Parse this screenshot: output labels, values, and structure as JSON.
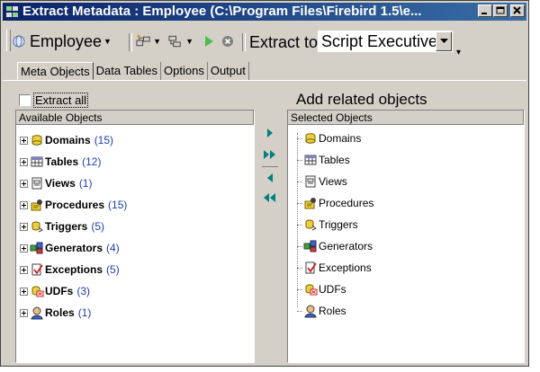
{
  "window": {
    "title": "Extract Metadata : Employee (C:\\Program Files\\Firebird 1.5\\e..."
  },
  "toolbar": {
    "database": "Employee",
    "extract_to_label": "Extract to",
    "extract_to_value": "Script Executive"
  },
  "tabs": [
    {
      "label": "Meta Objects",
      "active": true
    },
    {
      "label": "Data Tables",
      "active": false
    },
    {
      "label": "Options",
      "active": false
    },
    {
      "label": "Output",
      "active": false
    }
  ],
  "extract_all_label": "Extract all",
  "add_related_label": "Add related objects",
  "available": {
    "header": "Available Objects",
    "items": [
      {
        "name": "Domains",
        "count": "(15)",
        "icon": "domain-icon"
      },
      {
        "name": "Tables",
        "count": "(12)",
        "icon": "table-icon"
      },
      {
        "name": "Views",
        "count": "(1)",
        "icon": "view-icon"
      },
      {
        "name": "Procedures",
        "count": "(15)",
        "icon": "procedure-icon"
      },
      {
        "name": "Triggers",
        "count": "(5)",
        "icon": "trigger-icon"
      },
      {
        "name": "Generators",
        "count": "(4)",
        "icon": "generator-icon"
      },
      {
        "name": "Exceptions",
        "count": "(5)",
        "icon": "exception-icon"
      },
      {
        "name": "UDFs",
        "count": "(3)",
        "icon": "udf-icon"
      },
      {
        "name": "Roles",
        "count": "(1)",
        "icon": "role-icon"
      }
    ]
  },
  "selected": {
    "header": "Selected Objects",
    "items": [
      {
        "name": "Domains",
        "icon": "domain-icon"
      },
      {
        "name": "Tables",
        "icon": "table-icon"
      },
      {
        "name": "Views",
        "icon": "view-icon"
      },
      {
        "name": "Procedures",
        "icon": "procedure-icon"
      },
      {
        "name": "Triggers",
        "icon": "trigger-icon"
      },
      {
        "name": "Generators",
        "icon": "generator-icon"
      },
      {
        "name": "Exceptions",
        "icon": "exception-icon"
      },
      {
        "name": "UDFs",
        "icon": "udf-icon"
      },
      {
        "name": "Roles",
        "icon": "role-icon"
      }
    ]
  },
  "colors": {
    "title_bar": "#0a246a",
    "count_text": "#1c3cb0",
    "arrow_green": "#008080",
    "window_face": "#d4d0c8"
  }
}
